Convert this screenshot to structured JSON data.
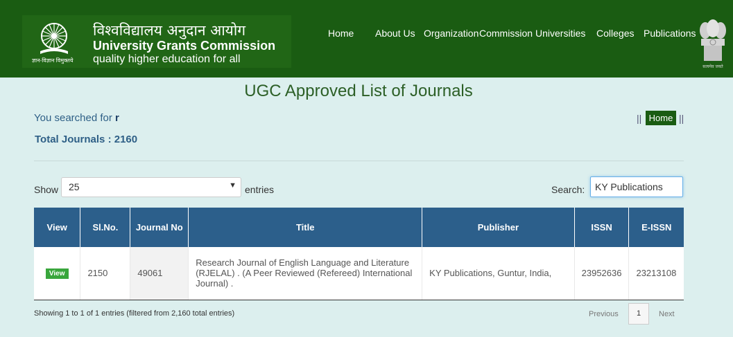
{
  "header": {
    "hindi_name": "विश्वविद्यालय अनुदान आयोग",
    "name": "University Grants Commission",
    "tagline": "quality higher education for all",
    "emblem_caption": "ज्ञान-विज्ञान विमुक्तये",
    "seal_caption": "सत्यमेव जयते",
    "nav": [
      "Home",
      "About Us",
      "Organization",
      "Commission",
      "Universities",
      "Colleges",
      "Publications"
    ]
  },
  "page": {
    "title": "UGC Approved List of Journals",
    "searched_prefix": "You searched for",
    "searched_term": "r",
    "total": "Total Journals : 2160",
    "breadcrumb_sep": "||",
    "home_button": "Home"
  },
  "controls": {
    "show_label": "Show",
    "page_size": "25",
    "entries_label": "entries",
    "search_label": "Search:",
    "search_value": "KY Publications"
  },
  "table": {
    "headers": [
      "View",
      "Sl.No.",
      "Journal No",
      "Title",
      "Publisher",
      "ISSN",
      "E-ISSN"
    ],
    "rows": [
      {
        "view": "View",
        "sl_no": "2150",
        "journal_no": "49061",
        "title": "Research Journal of English Language and Literature (RJELAL) . (A Peer Reviewed (Refereed) International Journal) .",
        "publisher": "KY Publications, Guntur, India,",
        "issn": "23952636",
        "e_issn": "23213108"
      }
    ]
  },
  "footer": {
    "info": "Showing 1 to 1 of 1 entries (filtered from 2,160 total entries)",
    "prev": "Previous",
    "current_page": "1",
    "next": "Next"
  },
  "colors": {
    "header_bg": "#1a5c12",
    "brand_bg": "#216616",
    "page_bg": "#dcefee",
    "table_header": "#2c5f8b",
    "view_button": "#39a63c"
  }
}
